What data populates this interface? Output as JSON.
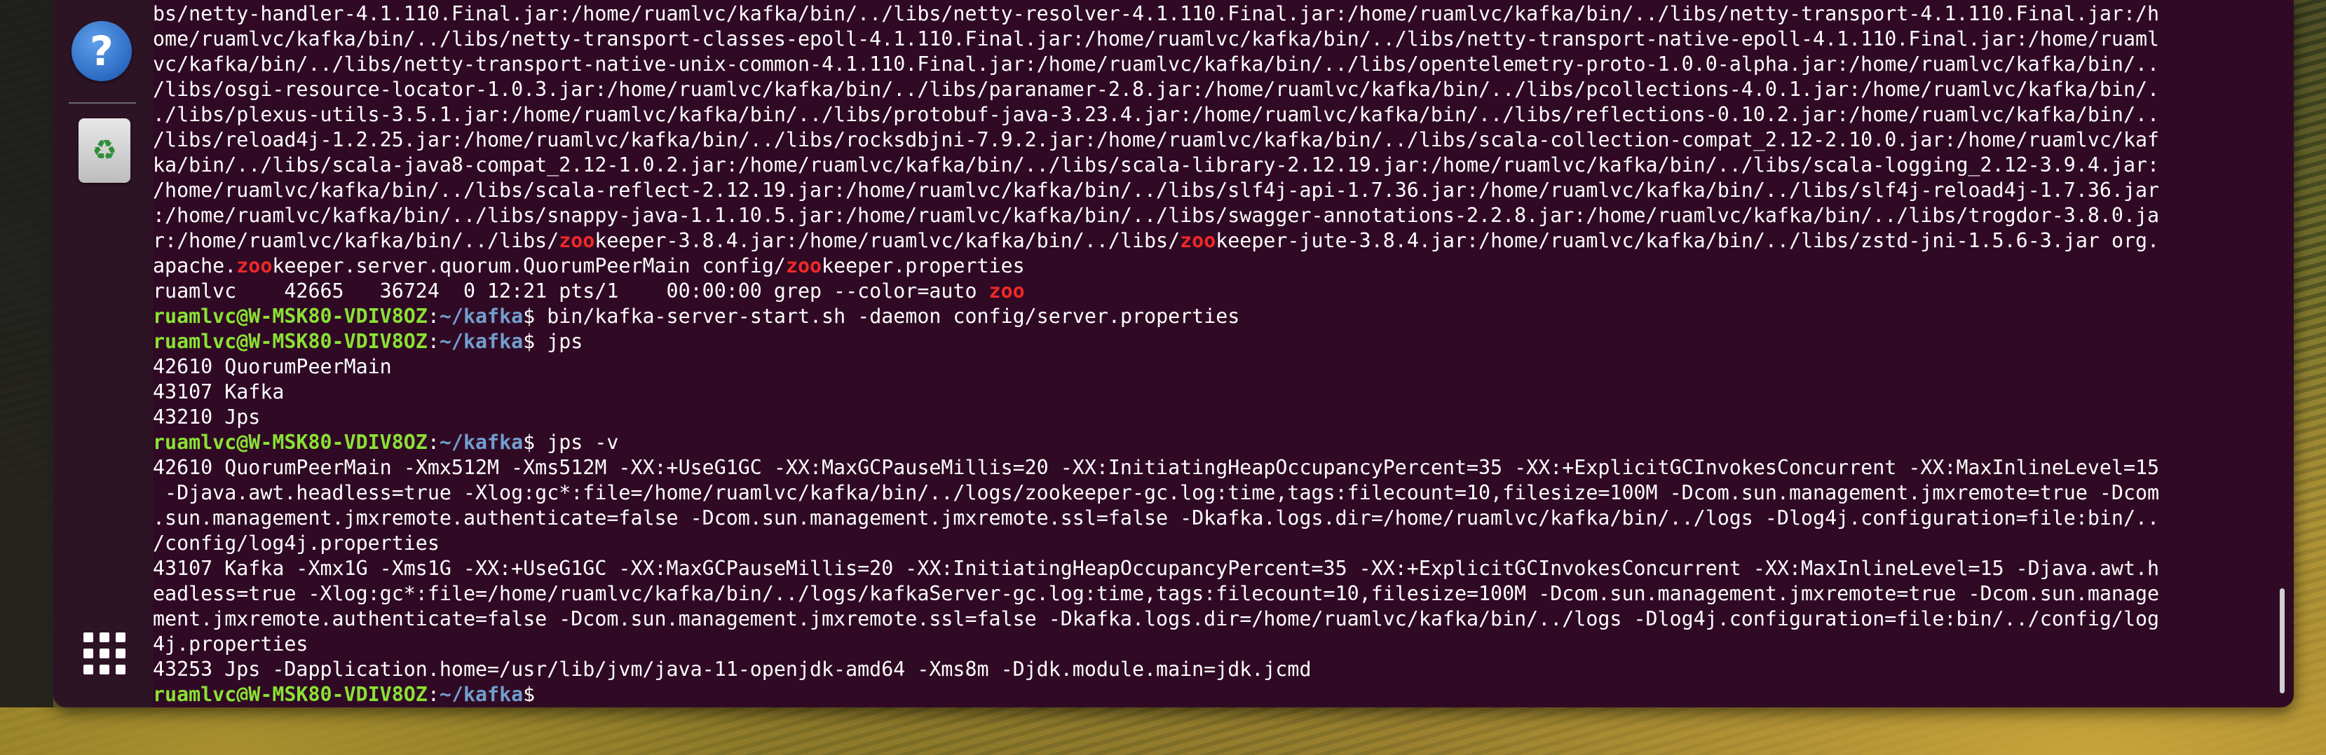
{
  "terminal": {
    "lines": [
      {
        "segments": [
          {
            "t": "bs/netty-handler-4.1.110.Final.jar:/home/ruamlvc/kafka/bin/../libs/netty-resolver-4.1.110.Final.jar:/home/ruamlvc/kafka/bin/../libs/netty-transport-4.1.110.Final.jar:/h",
            "c": "out"
          }
        ]
      },
      {
        "segments": [
          {
            "t": "ome/ruamlvc/kafka/bin/../libs/netty-transport-classes-epoll-4.1.110.Final.jar:/home/ruamlvc/kafka/bin/../libs/netty-transport-native-epoll-4.1.110.Final.jar:/home/ruaml",
            "c": "out"
          }
        ]
      },
      {
        "segments": [
          {
            "t": "vc/kafka/bin/../libs/netty-transport-native-unix-common-4.1.110.Final.jar:/home/ruamlvc/kafka/bin/../libs/opentelemetry-proto-1.0.0-alpha.jar:/home/ruamlvc/kafka/bin/..",
            "c": "out"
          }
        ]
      },
      {
        "segments": [
          {
            "t": "/libs/osgi-resource-locator-1.0.3.jar:/home/ruamlvc/kafka/bin/../libs/paranamer-2.8.jar:/home/ruamlvc/kafka/bin/../libs/pcollections-4.0.1.jar:/home/ruamlvc/kafka/bin/.",
            "c": "out"
          }
        ]
      },
      {
        "segments": [
          {
            "t": "./libs/plexus-utils-3.5.1.jar:/home/ruamlvc/kafka/bin/../libs/protobuf-java-3.23.4.jar:/home/ruamlvc/kafka/bin/../libs/reflections-0.10.2.jar:/home/ruamlvc/kafka/bin/..",
            "c": "out"
          }
        ]
      },
      {
        "segments": [
          {
            "t": "/libs/reload4j-1.2.25.jar:/home/ruamlvc/kafka/bin/../libs/rocksdbjni-7.9.2.jar:/home/ruamlvc/kafka/bin/../libs/scala-collection-compat_2.12-2.10.0.jar:/home/ruamlvc/kaf",
            "c": "out"
          }
        ]
      },
      {
        "segments": [
          {
            "t": "ka/bin/../libs/scala-java8-compat_2.12-1.0.2.jar:/home/ruamlvc/kafka/bin/../libs/scala-library-2.12.19.jar:/home/ruamlvc/kafka/bin/../libs/scala-logging_2.12-3.9.4.jar:",
            "c": "out"
          }
        ]
      },
      {
        "segments": [
          {
            "t": "/home/ruamlvc/kafka/bin/../libs/scala-reflect-2.12.19.jar:/home/ruamlvc/kafka/bin/../libs/slf4j-api-1.7.36.jar:/home/ruamlvc/kafka/bin/../libs/slf4j-reload4j-1.7.36.jar",
            "c": "out"
          }
        ]
      },
      {
        "segments": [
          {
            "t": ":/home/ruamlvc/kafka/bin/../libs/snappy-java-1.1.10.5.jar:/home/ruamlvc/kafka/bin/../libs/swagger-annotations-2.2.8.jar:/home/ruamlvc/kafka/bin/../libs/trogdor-3.8.0.ja",
            "c": "out"
          }
        ]
      },
      {
        "segments": [
          {
            "t": "r:/home/ruamlvc/kafka/bin/../libs/",
            "c": "out"
          },
          {
            "t": "zoo",
            "c": "match"
          },
          {
            "t": "keeper-3.8.4.jar:/home/ruamlvc/kafka/bin/../libs/",
            "c": "out"
          },
          {
            "t": "zoo",
            "c": "match"
          },
          {
            "t": "keeper-jute-3.8.4.jar:/home/ruamlvc/kafka/bin/../libs/zstd-jni-1.5.6-3.jar org.",
            "c": "out"
          }
        ]
      },
      {
        "segments": [
          {
            "t": "apache.",
            "c": "out"
          },
          {
            "t": "zoo",
            "c": "match"
          },
          {
            "t": "keeper.server.quorum.QuorumPeerMain config/",
            "c": "out"
          },
          {
            "t": "zoo",
            "c": "match"
          },
          {
            "t": "keeper.properties",
            "c": "out"
          }
        ]
      },
      {
        "segments": [
          {
            "t": "ruamlvc    42665   36724  0 12:21 pts/1    00:00:00 grep --color=auto ",
            "c": "out"
          },
          {
            "t": "zoo",
            "c": "match"
          }
        ]
      },
      {
        "segments": [
          {
            "t": "ruamlvc@W-MSK80-VDIV8OZ",
            "c": "user"
          },
          {
            "t": ":",
            "c": "out"
          },
          {
            "t": "~/kafka",
            "c": "path"
          },
          {
            "t": "$ bin/kafka-server-start.sh -daemon config/server.properties",
            "c": "out"
          }
        ]
      },
      {
        "segments": [
          {
            "t": "ruamlvc@W-MSK80-VDIV8OZ",
            "c": "user"
          },
          {
            "t": ":",
            "c": "out"
          },
          {
            "t": "~/kafka",
            "c": "path"
          },
          {
            "t": "$ jps",
            "c": "out"
          }
        ]
      },
      {
        "segments": [
          {
            "t": "42610 QuorumPeerMain",
            "c": "out"
          }
        ]
      },
      {
        "segments": [
          {
            "t": "43107 Kafka",
            "c": "out"
          }
        ]
      },
      {
        "segments": [
          {
            "t": "43210 Jps",
            "c": "out"
          }
        ]
      },
      {
        "segments": [
          {
            "t": "ruamlvc@W-MSK80-VDIV8OZ",
            "c": "user"
          },
          {
            "t": ":",
            "c": "out"
          },
          {
            "t": "~/kafka",
            "c": "path"
          },
          {
            "t": "$ jps -v",
            "c": "out"
          }
        ]
      },
      {
        "segments": [
          {
            "t": "42610 QuorumPeerMain -Xmx512M -Xms512M -XX:+UseG1GC -XX:MaxGCPauseMillis=20 -XX:InitiatingHeapOccupancyPercent=35 -XX:+ExplicitGCInvokesConcurrent -XX:MaxInlineLevel=15",
            "c": "out"
          }
        ]
      },
      {
        "segments": [
          {
            "t": " -Djava.awt.headless=true -Xlog:gc*:file=/home/ruamlvc/kafka/bin/../logs/zookeeper-gc.log:time,tags:filecount=10,filesize=100M -Dcom.sun.management.jmxremote=true -Dcom",
            "c": "out"
          }
        ]
      },
      {
        "segments": [
          {
            "t": ".sun.management.jmxremote.authenticate=false -Dcom.sun.management.jmxremote.ssl=false -Dkafka.logs.dir=/home/ruamlvc/kafka/bin/../logs -Dlog4j.configuration=file:bin/..",
            "c": "out"
          }
        ]
      },
      {
        "segments": [
          {
            "t": "/config/log4j.properties",
            "c": "out"
          }
        ]
      },
      {
        "segments": [
          {
            "t": "43107 Kafka -Xmx1G -Xms1G -XX:+UseG1GC -XX:MaxGCPauseMillis=20 -XX:InitiatingHeapOccupancyPercent=35 -XX:+ExplicitGCInvokesConcurrent -XX:MaxInlineLevel=15 -Djava.awt.h",
            "c": "out"
          }
        ]
      },
      {
        "segments": [
          {
            "t": "eadless=true -Xlog:gc*:file=/home/ruamlvc/kafka/bin/../logs/kafkaServer-gc.log:time,tags:filecount=10,filesize=100M -Dcom.sun.management.jmxremote=true -Dcom.sun.manage",
            "c": "out"
          }
        ]
      },
      {
        "segments": [
          {
            "t": "ment.jmxremote.authenticate=false -Dcom.sun.management.jmxremote.ssl=false -Dkafka.logs.dir=/home/ruamlvc/kafka/bin/../logs -Dlog4j.configuration=file:bin/../config/log",
            "c": "out"
          }
        ]
      },
      {
        "segments": [
          {
            "t": "4j.properties",
            "c": "out"
          }
        ]
      },
      {
        "segments": [
          {
            "t": "43253 Jps -Dapplication.home=/usr/lib/jvm/java-11-openjdk-amd64 -Xms8m -Djdk.module.main=jdk.jcmd",
            "c": "out"
          }
        ]
      },
      {
        "segments": [
          {
            "t": "ruamlvc@W-MSK80-VDIV8OZ",
            "c": "user"
          },
          {
            "t": ":",
            "c": "out"
          },
          {
            "t": "~/kafka",
            "c": "path"
          },
          {
            "t": "$ ",
            "c": "out"
          }
        ]
      }
    ]
  },
  "dock": {
    "help_glyph": "?",
    "trash_glyph": "♻",
    "icons": [
      "help-icon",
      "trash-icon",
      "show-apps-icon"
    ]
  },
  "colors": {
    "terminal_bg": "#300a24",
    "prompt_user": "#8ae234",
    "prompt_path": "#729fcf",
    "grep_match": "#ef2929"
  }
}
